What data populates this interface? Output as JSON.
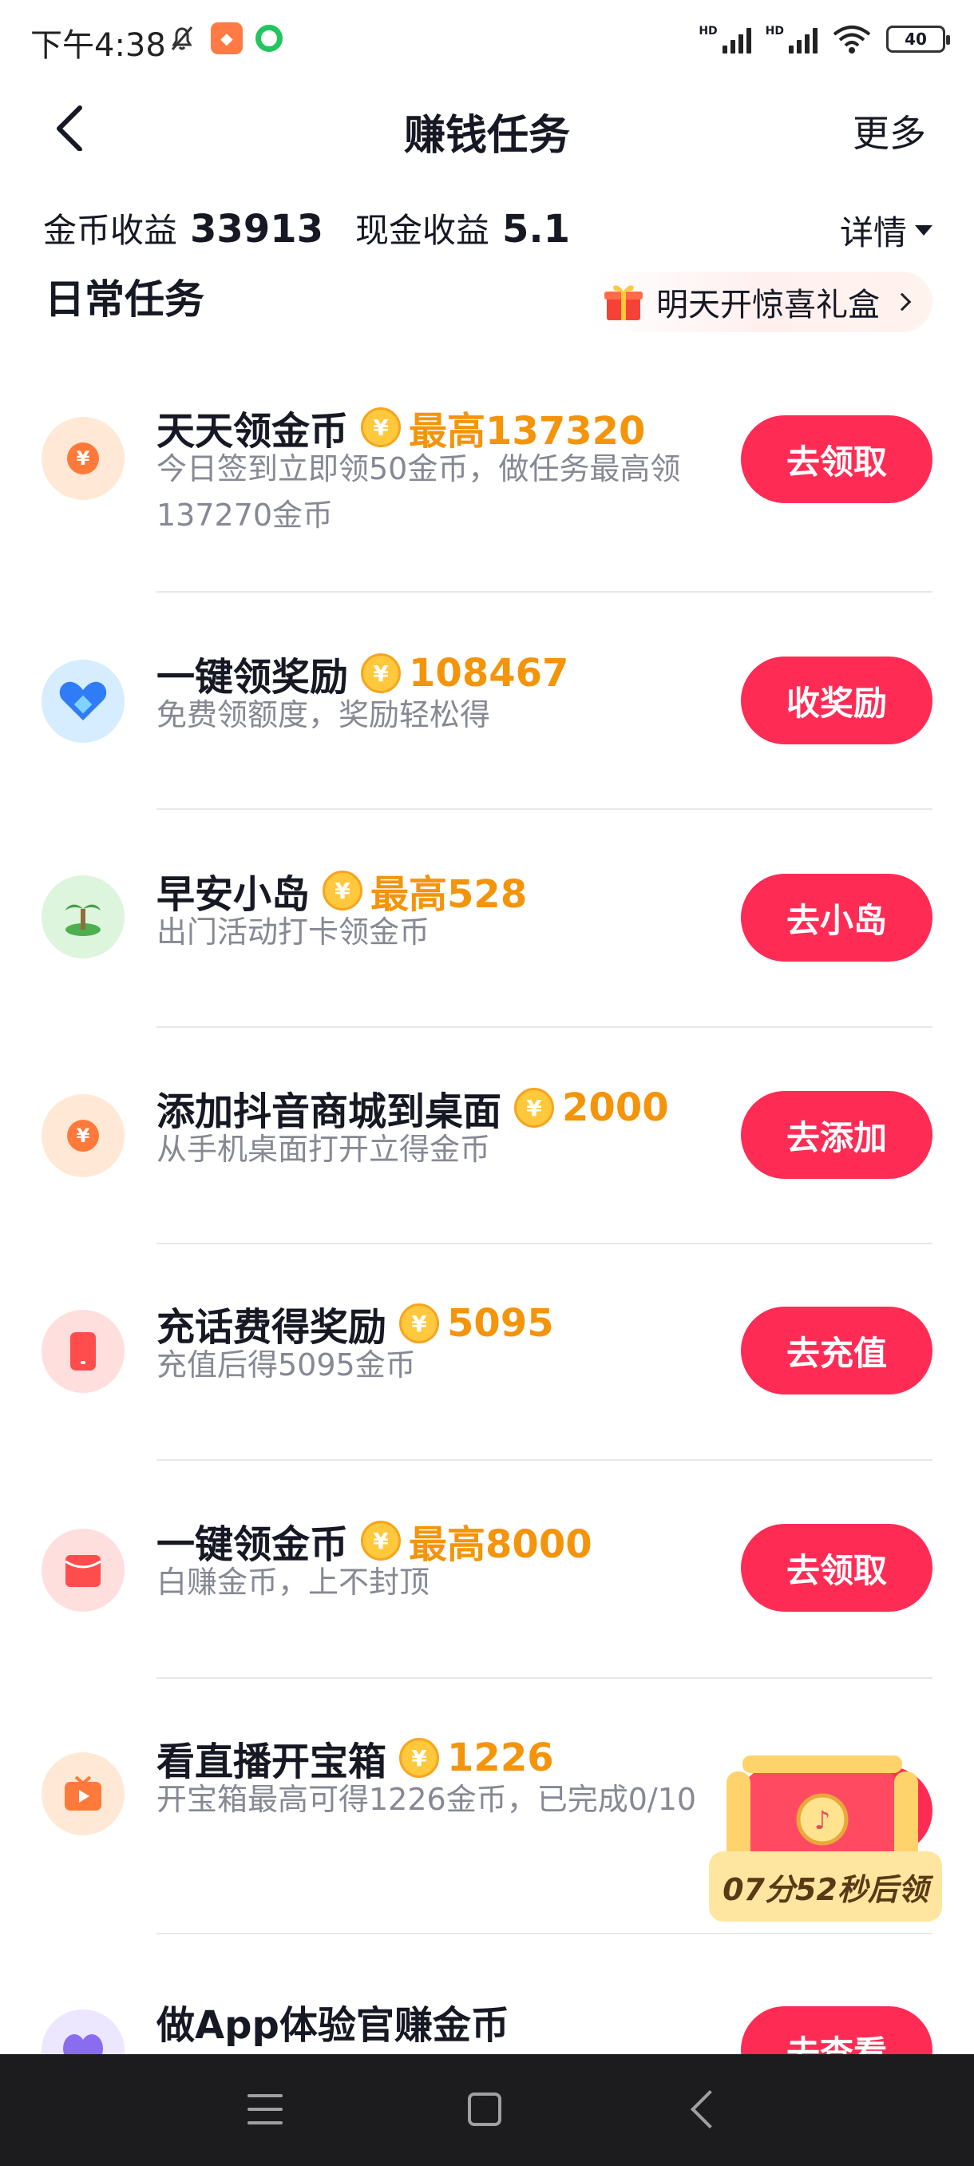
{
  "status_bar": {
    "time": "下午4:38",
    "battery": "40",
    "hd": "HD"
  },
  "nav": {
    "title": "赚钱任务",
    "more": "更多"
  },
  "earnings": {
    "coin_label": "金币收益",
    "coin_value": "33913",
    "cash_label": "现金收益",
    "cash_value": "5.1",
    "details": "详情"
  },
  "section": {
    "title": "日常任务",
    "banner": "明天开惊喜礼盒"
  },
  "tasks": [
    {
      "title": "天天领金币",
      "reward": "最高137320",
      "desc": "今日签到立即领50金币，做任务最高领137270金币",
      "button": "去领取",
      "icon": "coin-icon"
    },
    {
      "title": "一键领奖励",
      "reward": "108467",
      "desc": "免费领额度，奖励轻松得",
      "button": "收奖励",
      "icon": "heart-icon"
    },
    {
      "title": "早安小岛",
      "reward": "最高528",
      "desc": "出门活动打卡领金币",
      "button": "去小岛",
      "icon": "island-icon"
    },
    {
      "title": "添加抖音商城到桌面",
      "reward": "2000",
      "desc": "从手机桌面打开立得金币",
      "button": "去添加",
      "icon": "coin-icon"
    },
    {
      "title": "充话费得奖励",
      "reward": "5095",
      "desc": "充值后得5095金币",
      "button": "去充值",
      "icon": "phone-icon"
    },
    {
      "title": "一键领金币",
      "reward": "最高8000",
      "desc": "白赚金币，上不封顶",
      "button": "去领取",
      "icon": "red-envelope-icon"
    },
    {
      "title": "看直播开宝箱",
      "reward": "1226",
      "desc": "开宝箱最高可得1226金币，已完成0/10",
      "button": "",
      "icon": "live-tv-icon"
    },
    {
      "title": "做App体验官赚金币",
      "reward": "",
      "desc": "",
      "button": "去查看",
      "icon": "butterfly-icon"
    }
  ],
  "treasure": {
    "countdown": "07分52秒后领"
  },
  "coin_symbol": "¥"
}
